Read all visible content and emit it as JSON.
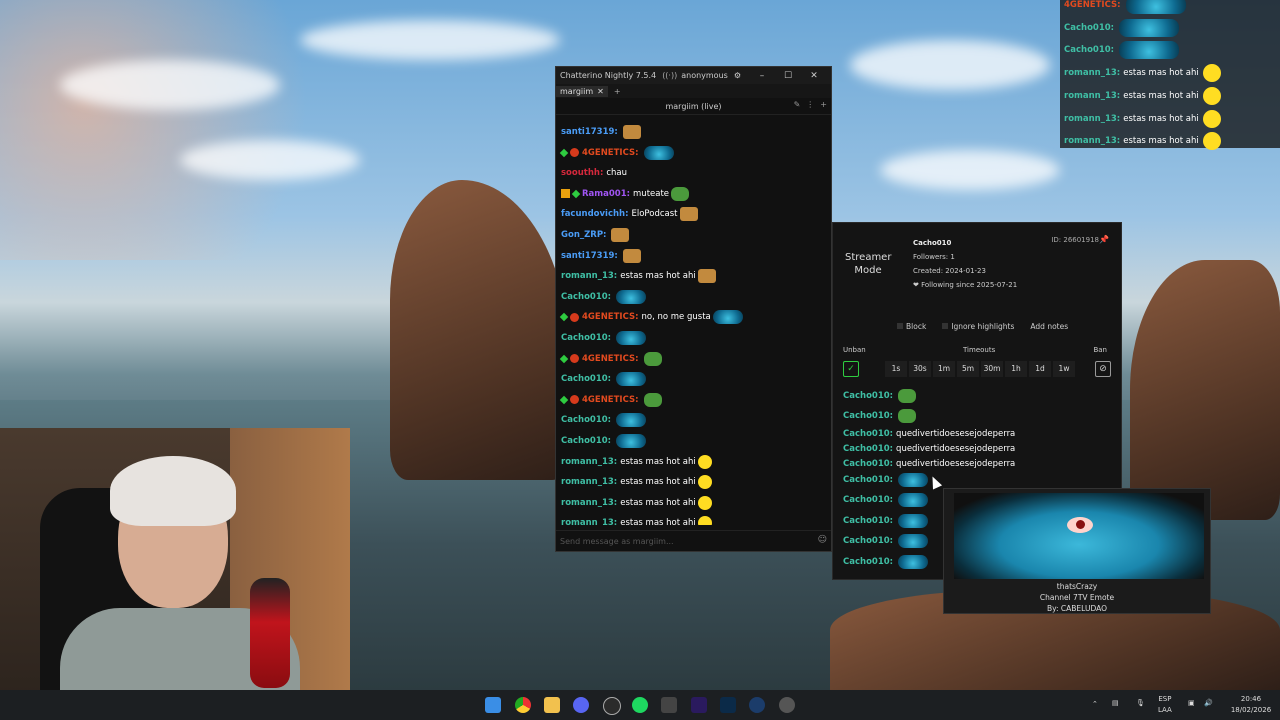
{
  "window": {
    "title": "Chatterino Nightly 7.5.4",
    "account": "anonymous",
    "tab_label": "margiim",
    "channel_header": "margiim (live)",
    "input_placeholder": "Send message as margiim..."
  },
  "messages": [
    {
      "user": "santi17319:",
      "color": "#4a9cf6",
      "text": "",
      "badges": [],
      "emote": "bread"
    },
    {
      "user": "4GENETICS:",
      "color": "#e24a1f",
      "text": "",
      "badges": [
        "green",
        "red"
      ],
      "emote": "blob"
    },
    {
      "user": "soouthh:",
      "color": "#d6283c",
      "text": "chau",
      "badges": [],
      "emote": ""
    },
    {
      "user": "Rama001:",
      "color": "#a155f3",
      "text": "muteate",
      "badges": [
        "yellow",
        "green"
      ],
      "emote": "pepe"
    },
    {
      "user": "facundovichh:",
      "color": "#4a9cf6",
      "text": "EloPodcast",
      "badges": [],
      "emote": "bread"
    },
    {
      "user": "Gon_ZRP:",
      "color": "#4a9cf6",
      "text": "",
      "badges": [],
      "emote": "bread"
    },
    {
      "user": "santi17319:",
      "color": "#4a9cf6",
      "text": "",
      "badges": [],
      "emote": "bread"
    },
    {
      "user": "romann_13:",
      "color": "#3fbfa5",
      "text": "estas mas hot ahi",
      "badges": [],
      "emote": "bread"
    },
    {
      "user": "Cacho010:",
      "color": "#3fbfa5",
      "text": "",
      "badges": [],
      "emote": "blob"
    },
    {
      "user": "4GENETICS:",
      "color": "#e24a1f",
      "text": "no, no me gusta",
      "badges": [
        "green",
        "red"
      ],
      "emote": "blob"
    },
    {
      "user": "Cacho010:",
      "color": "#3fbfa5",
      "text": "",
      "badges": [],
      "emote": "blob"
    },
    {
      "user": "4GENETICS:",
      "color": "#e24a1f",
      "text": "",
      "badges": [
        "green",
        "red"
      ],
      "emote": "pepe"
    },
    {
      "user": "Cacho010:",
      "color": "#3fbfa5",
      "text": "",
      "badges": [],
      "emote": "blob"
    },
    {
      "user": "4GENETICS:",
      "color": "#e24a1f",
      "text": "",
      "badges": [
        "green",
        "red"
      ],
      "emote": "pepe"
    },
    {
      "user": "Cacho010:",
      "color": "#3fbfa5",
      "text": "",
      "badges": [],
      "emote": "blob"
    },
    {
      "user": "Cacho010:",
      "color": "#3fbfa5",
      "text": "",
      "badges": [],
      "emote": "blob"
    },
    {
      "user": "romann_13:",
      "color": "#3fbfa5",
      "text": "estas mas hot ahi",
      "badges": [],
      "emote": "smile"
    },
    {
      "user": "romann_13:",
      "color": "#3fbfa5",
      "text": "estas mas hot ahi",
      "badges": [],
      "emote": "smile"
    },
    {
      "user": "romann_13:",
      "color": "#3fbfa5",
      "text": "estas mas hot ahi",
      "badges": [],
      "emote": "smile"
    },
    {
      "user": "romann_13:",
      "color": "#3fbfa5",
      "text": "estas mas hot ahi",
      "badges": [],
      "emote": "smile"
    }
  ],
  "popup": {
    "streamer_mode": "Streamer Mode",
    "username": "Cacho010",
    "id": "ID: 26601918",
    "followers": "Followers: 1",
    "created": "Created: 2024-01-23",
    "following": "❤ Following since 2025-07-21",
    "block": "Block",
    "ignore": "Ignore highlights",
    "notes": "Add notes",
    "unban": "Unban",
    "timeouts": "Timeouts",
    "ban": "Ban",
    "durations": [
      "1s",
      "30s",
      "1m",
      "5m",
      "30m",
      "1h",
      "1d",
      "1w"
    ],
    "messages": [
      {
        "user": "Cacho010:",
        "text": "",
        "emote": "pepe"
      },
      {
        "user": "Cacho010:",
        "text": "",
        "emote": "pepe"
      },
      {
        "user": "Cacho010:",
        "text": "quedivertidoesesejodeperra",
        "emote": ""
      },
      {
        "user": "Cacho010:",
        "text": "quedivertidoesesejodeperra",
        "emote": ""
      },
      {
        "user": "Cacho010:",
        "text": "quedivertidoesesejodeperra",
        "emote": ""
      },
      {
        "user": "Cacho010:",
        "text": "",
        "emote": "blob"
      },
      {
        "user": "Cacho010:",
        "text": "",
        "emote": "blob"
      },
      {
        "user": "Cacho010:",
        "text": "",
        "emote": "blob"
      },
      {
        "user": "Cacho010:",
        "text": "",
        "emote": "blob"
      },
      {
        "user": "Cacho010:",
        "text": "",
        "emote": "blob"
      }
    ]
  },
  "tooltip": {
    "name": "thatsCrazy",
    "kind": "Channel 7TV Emote",
    "author": "By: CABELUDAO"
  },
  "overlay": [
    {
      "user": "4GENETICS:",
      "color": "#e24a1f",
      "text": ""
    },
    {
      "user": "Cacho010:",
      "color": "#3fbfa5",
      "text": ""
    },
    {
      "user": "Cacho010:",
      "color": "#3fbfa5",
      "text": ""
    },
    {
      "user": "romann_13:",
      "color": "#3fbfa5",
      "text": "estas mas hot ahi"
    },
    {
      "user": "romann_13:",
      "color": "#3fbfa5",
      "text": "estas mas hot ahi"
    },
    {
      "user": "romann_13:",
      "color": "#3fbfa5",
      "text": "estas mas hot ahi"
    },
    {
      "user": "romann_13:",
      "color": "#3fbfa5",
      "text": "estas mas hot ahi"
    }
  ],
  "taskbar": {
    "lang": "ESP",
    "lang2": "LAA",
    "time": "20:46",
    "date": "18/02/2026"
  }
}
